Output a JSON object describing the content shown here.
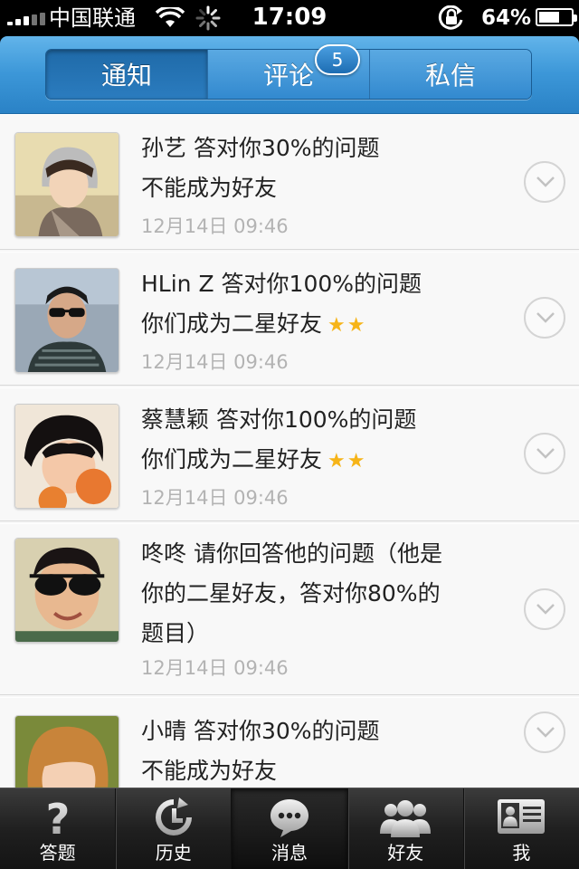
{
  "status_bar": {
    "carrier": "中国联通",
    "time": "17:09",
    "battery_percent_label": "64%",
    "battery_level": 0.64
  },
  "tabs": [
    {
      "label": "通知",
      "active": true
    },
    {
      "label": "评论",
      "badge": "5"
    },
    {
      "label": "私信"
    }
  ],
  "notifications": [
    {
      "line1": "孙艺 答对你30%的问题",
      "line2": "不能成为好友",
      "stars": "",
      "time": "12月14日 09:46"
    },
    {
      "line1": "HLin Z 答对你100%的问题",
      "line2": "你们成为二星好友",
      "stars": "★★",
      "time": "12月14日 09:46"
    },
    {
      "line1": "蔡慧颖 答对你100%的问题",
      "line2": "你们成为二星好友",
      "stars": "★★",
      "time": "12月14日 09:46"
    },
    {
      "line1": "咚咚 请你回答他的问题（他是",
      "line2": "你的二星好友，答对你80%的",
      "line3": "题目）",
      "stars": "",
      "time": "12月14日 09:46"
    },
    {
      "line1": "小晴 答对你30%的问题",
      "line2": "不能成为好友",
      "stars": "",
      "time": ""
    }
  ],
  "tabbar": [
    {
      "label": "答题",
      "icon": "question-icon"
    },
    {
      "label": "历史",
      "icon": "history-clock-icon"
    },
    {
      "label": "消息",
      "icon": "message-bubble-icon",
      "active": true
    },
    {
      "label": "好友",
      "icon": "friends-icon"
    },
    {
      "label": "我",
      "icon": "profile-card-icon"
    }
  ],
  "colors": {
    "header_blue": "#3c97d8",
    "star": "#f6b418",
    "timestamp": "#b3b3b3"
  }
}
